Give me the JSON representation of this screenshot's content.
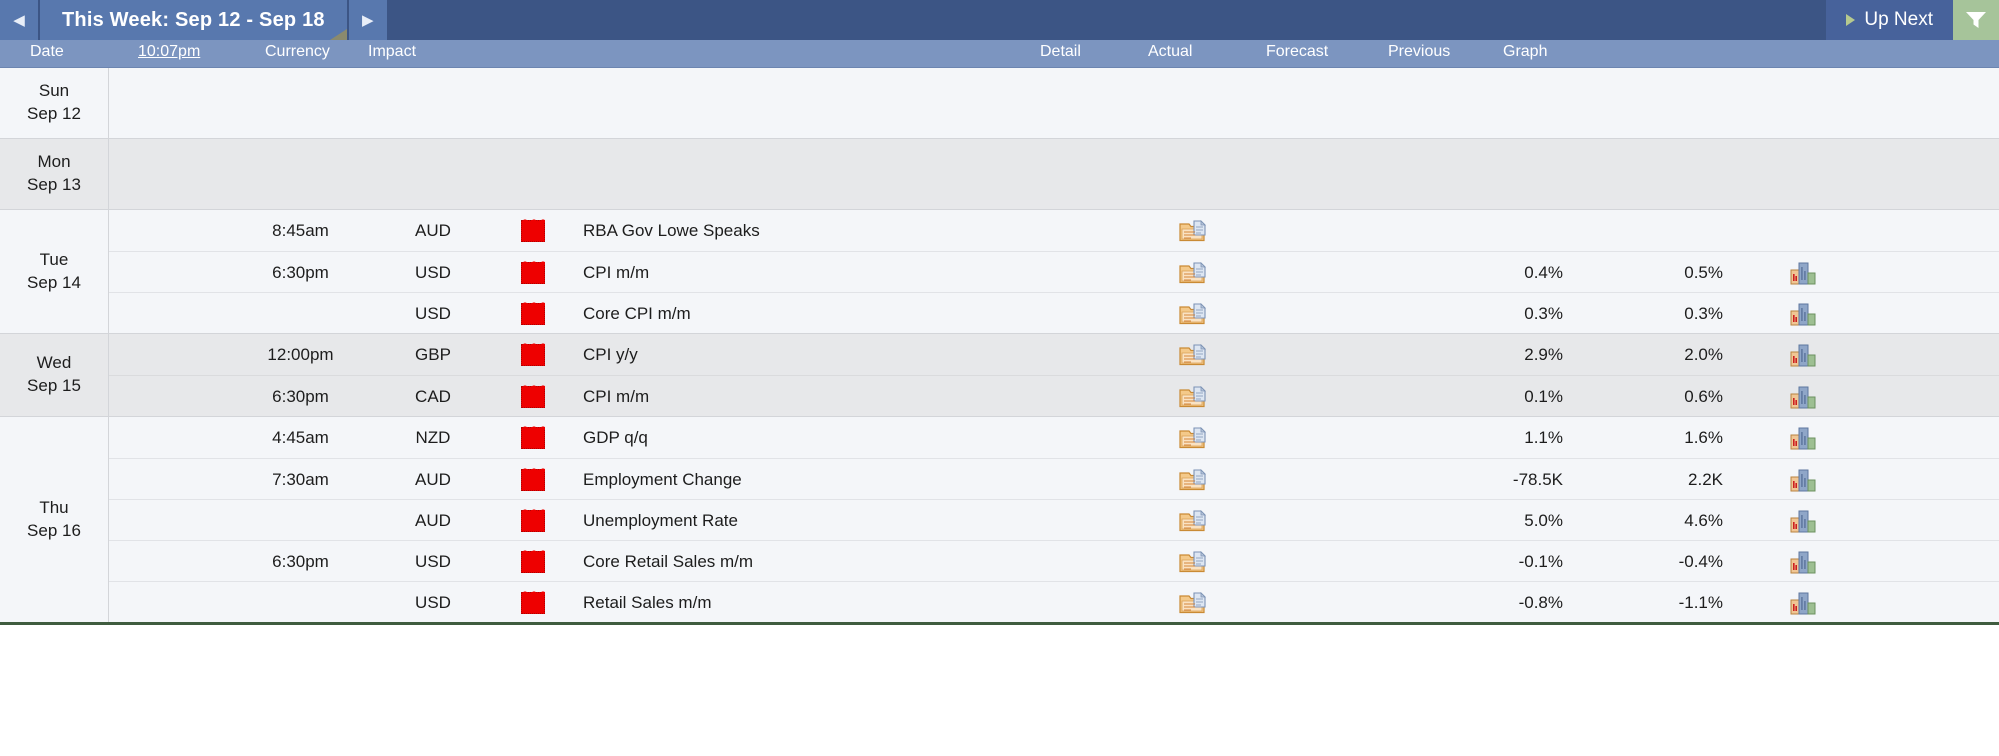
{
  "topbar": {
    "prev_label": "◀",
    "week_title": "This Week: Sep 12 - Sep 18",
    "next_label": "▶",
    "up_next_label": "Up Next",
    "filter_icon": "filter-funnel-icon",
    "accent_bar": "#3c5585",
    "accent_button": "#5878ae",
    "filter_green": "#a6c49a"
  },
  "columns": {
    "date": "Date",
    "clock": "10:07pm",
    "currency": "Currency",
    "impact": "Impact",
    "detail": "Detail",
    "actual": "Actual",
    "forecast": "Forecast",
    "previous": "Previous",
    "graph": "Graph"
  },
  "impact_color": "#ee0000",
  "days": [
    {
      "day": "Sun",
      "date": "Sep 12",
      "shaded": false,
      "events": []
    },
    {
      "day": "Mon",
      "date": "Sep 13",
      "shaded": true,
      "events": []
    },
    {
      "day": "Tue",
      "date": "Sep 14",
      "shaded": false,
      "events": [
        {
          "time": "8:45am",
          "currency": "AUD",
          "impact": "high",
          "event": "RBA Gov Lowe Speaks",
          "detail": true,
          "actual": "",
          "forecast": "",
          "previous": "",
          "graph": false
        },
        {
          "time": "6:30pm",
          "currency": "USD",
          "impact": "high",
          "event": "CPI m/m",
          "detail": true,
          "actual": "",
          "forecast": "0.4%",
          "previous": "0.5%",
          "graph": true
        },
        {
          "time": "",
          "currency": "USD",
          "impact": "high",
          "event": "Core CPI m/m",
          "detail": true,
          "actual": "",
          "forecast": "0.3%",
          "previous": "0.3%",
          "graph": true
        }
      ]
    },
    {
      "day": "Wed",
      "date": "Sep 15",
      "shaded": true,
      "events": [
        {
          "time": "12:00pm",
          "currency": "GBP",
          "impact": "high",
          "event": "CPI y/y",
          "detail": true,
          "actual": "",
          "forecast": "2.9%",
          "previous": "2.0%",
          "graph": true
        },
        {
          "time": "6:30pm",
          "currency": "CAD",
          "impact": "high",
          "event": "CPI m/m",
          "detail": true,
          "actual": "",
          "forecast": "0.1%",
          "previous": "0.6%",
          "graph": true
        }
      ]
    },
    {
      "day": "Thu",
      "date": "Sep 16",
      "shaded": false,
      "events": [
        {
          "time": "4:45am",
          "currency": "NZD",
          "impact": "high",
          "event": "GDP q/q",
          "detail": true,
          "actual": "",
          "forecast": "1.1%",
          "previous": "1.6%",
          "graph": true
        },
        {
          "time": "7:30am",
          "currency": "AUD",
          "impact": "high",
          "event": "Employment Change",
          "detail": true,
          "actual": "",
          "forecast": "-78.5K",
          "previous": "2.2K",
          "graph": true
        },
        {
          "time": "",
          "currency": "AUD",
          "impact": "high",
          "event": "Unemployment Rate",
          "detail": true,
          "actual": "",
          "forecast": "5.0%",
          "previous": "4.6%",
          "graph": true
        },
        {
          "time": "6:30pm",
          "currency": "USD",
          "impact": "high",
          "event": "Core Retail Sales m/m",
          "detail": true,
          "actual": "",
          "forecast": "-0.1%",
          "previous": "-0.4%",
          "graph": true
        },
        {
          "time": "",
          "currency": "USD",
          "impact": "high",
          "event": "Retail Sales m/m",
          "detail": true,
          "actual": "",
          "forecast": "-0.8%",
          "previous": "-1.1%",
          "graph": true
        }
      ]
    }
  ]
}
